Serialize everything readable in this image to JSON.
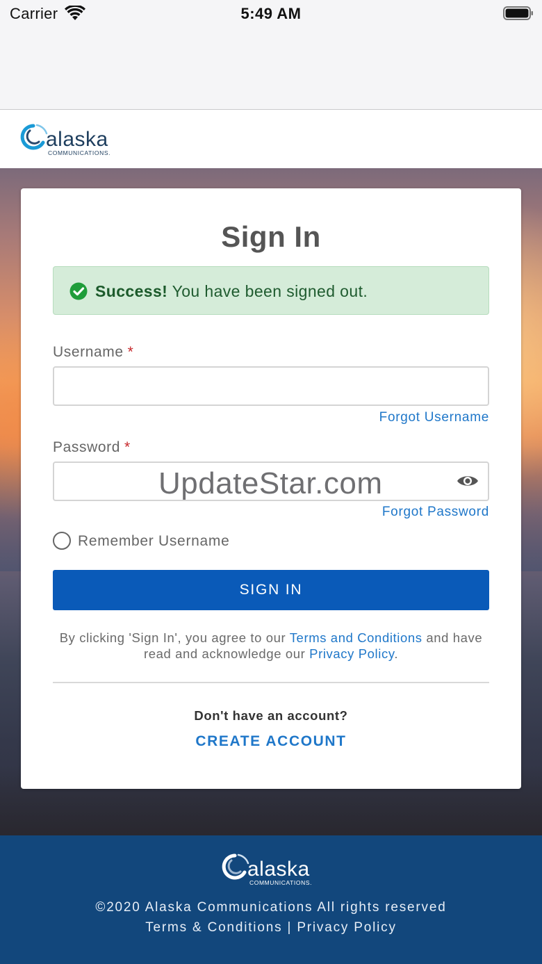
{
  "status_bar": {
    "carrier": "Carrier",
    "time": "5:49 AM"
  },
  "brand": {
    "name": "alaska",
    "subtitle": "COMMUNICATIONS.",
    "accent": "#1a9ad6"
  },
  "card": {
    "title": "Sign In",
    "alert": {
      "strong": "Success!",
      "message": "You have been signed out.",
      "color": "#d5ecd9"
    },
    "username": {
      "label": "Username",
      "required_mark": "*",
      "value": "",
      "forgot_link": "Forgot Username"
    },
    "password": {
      "label": "Password",
      "required_mark": "*",
      "value": "",
      "forgot_link": "Forgot Password"
    },
    "watermark": "UpdateStar.com",
    "remember_label": "Remember Username",
    "sign_in_label": "SIGN IN",
    "agreement": {
      "prefix": "By clicking 'Sign In', you agree to our",
      "terms_link": "Terms and Conditions",
      "middle": "and have read and acknowledge our",
      "privacy_link": "Privacy Policy",
      "suffix": "."
    },
    "no_account": "Don't have an account?",
    "create_account": "CREATE ACCOUNT"
  },
  "footer": {
    "copyright": "©2020 Alaska Communications All rights reserved",
    "terms": "Terms & Conditions",
    "separator": "|",
    "privacy": "Privacy Policy",
    "background": "#12477c"
  },
  "colors": {
    "primary_button": "#0a5ab8",
    "link": "#1f77c9",
    "required": "#c6282b",
    "success_icon": "#1f9d3a"
  }
}
